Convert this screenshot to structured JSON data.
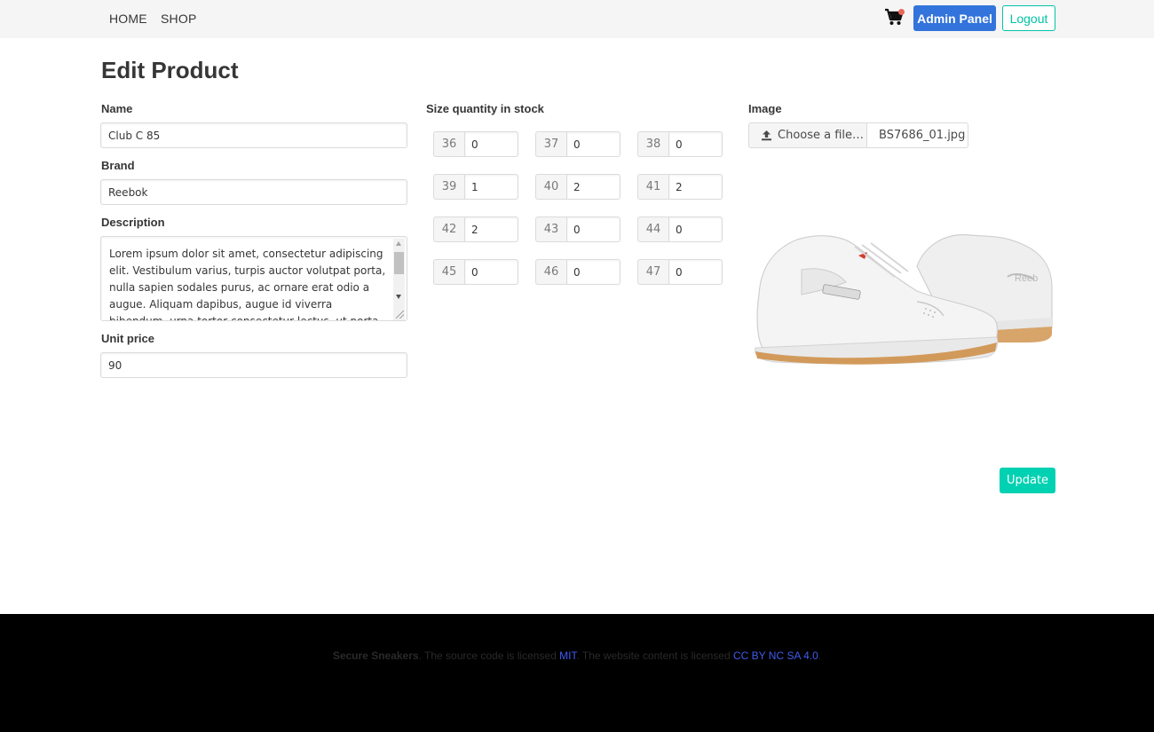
{
  "nav": {
    "home": "HOME",
    "shop": "SHOP",
    "cart_icon": "shopping-cart-icon",
    "admin_panel": "Admin Panel",
    "logout": "Logout"
  },
  "page": {
    "title": "Edit Product"
  },
  "form": {
    "name_label": "Name",
    "name_value": "Club C 85",
    "brand_label": "Brand",
    "brand_value": "Reebok",
    "description_label": "Description",
    "description_value": "Lorem ipsum dolor sit amet, consectetur adipiscing elit. Vestibulum varius, turpis auctor volutpat porta, nulla sapien sodales purus, ac ornare erat odio a augue. Aliquam dapibus, augue id viverra bibendum, urna tortor consectetur lectus, ut porta diam nisi at",
    "unit_price_label": "Unit price",
    "unit_price_value": "90",
    "sizes_label": "Size quantity in stock",
    "sizes": [
      {
        "size": "36",
        "qty": "0"
      },
      {
        "size": "37",
        "qty": "0"
      },
      {
        "size": "38",
        "qty": "0"
      },
      {
        "size": "39",
        "qty": "1"
      },
      {
        "size": "40",
        "qty": "2"
      },
      {
        "size": "41",
        "qty": "2"
      },
      {
        "size": "42",
        "qty": "2"
      },
      {
        "size": "43",
        "qty": "0"
      },
      {
        "size": "44",
        "qty": "0"
      },
      {
        "size": "45",
        "qty": "0"
      },
      {
        "size": "46",
        "qty": "0"
      },
      {
        "size": "47",
        "qty": "0"
      }
    ],
    "image_label": "Image",
    "file_button": "Choose a file…",
    "file_name": "BS7686_01.jpg",
    "update_button": "Update"
  },
  "footer": {
    "brand": "Secure Sneakers",
    "text_1": ". The source code is licensed ",
    "mit_link": "MIT",
    "text_2": ". The website content is licensed ",
    "cc_link": "CC BY NC SA 4.0",
    "text_3": "."
  },
  "colors": {
    "primary": "#3273dc",
    "accent": "#00d1b2",
    "navbar_bg": "#f5f5f5",
    "footer_bg": "#000000",
    "link": "#3f5bf0"
  }
}
